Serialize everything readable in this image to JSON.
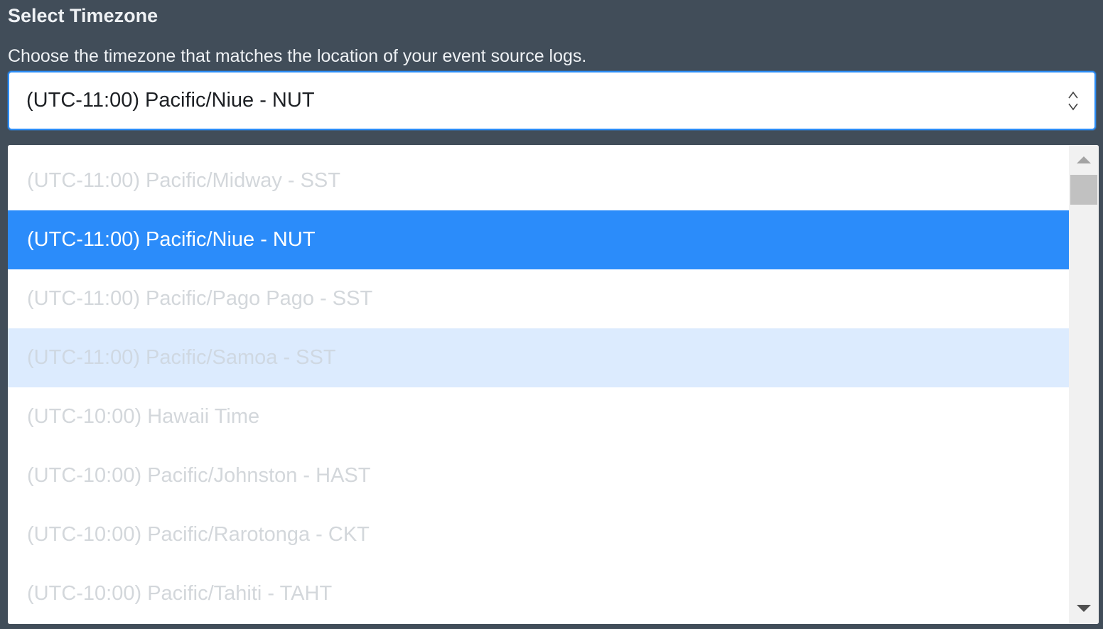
{
  "header": {
    "title": "Select Timezone",
    "description": "Choose the timezone that matches the location of your event source logs."
  },
  "select": {
    "value": "(UTC-11:00) Pacific/Niue - NUT",
    "arrows_icon": "up-down-chevron-icon"
  },
  "dropdown": {
    "options": [
      {
        "label": "(UTC-11:00) Pacific/Midway - SST",
        "state": "normal"
      },
      {
        "label": "(UTC-11:00) Pacific/Niue - NUT",
        "state": "selected"
      },
      {
        "label": "(UTC-11:00) Pacific/Pago Pago - SST",
        "state": "normal"
      },
      {
        "label": "(UTC-11:00) Pacific/Samoa - SST",
        "state": "hovered"
      },
      {
        "label": "(UTC-10:00) Hawaii Time",
        "state": "normal"
      },
      {
        "label": "(UTC-10:00) Pacific/Johnston - HAST",
        "state": "normal"
      },
      {
        "label": "(UTC-10:00) Pacific/Rarotonga - CKT",
        "state": "normal"
      },
      {
        "label": "(UTC-10:00) Pacific/Tahiti - TAHT",
        "state": "normal"
      }
    ]
  },
  "colors": {
    "background": "#414d59",
    "accent": "#2b8cfa",
    "hover": "#dcebfe"
  }
}
